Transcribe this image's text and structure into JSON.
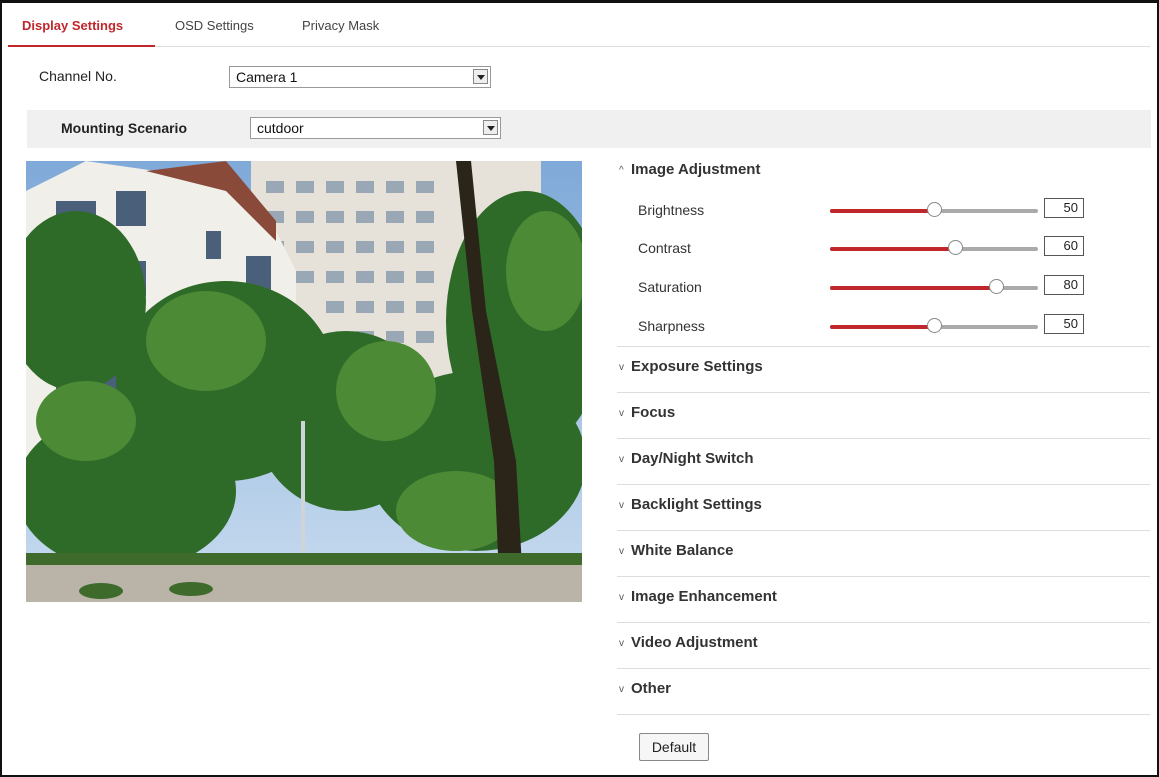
{
  "tabs": [
    {
      "label": "Display Settings",
      "active": true
    },
    {
      "label": "OSD Settings",
      "active": false
    },
    {
      "label": "Privacy Mask",
      "active": false
    }
  ],
  "channel": {
    "label": "Channel No.",
    "value": "Camera 1"
  },
  "mounting": {
    "label": "Mounting Scenario",
    "value": "cutdoor"
  },
  "image_adjustment": {
    "title": "Image Adjustment",
    "sliders": [
      {
        "name": "Brightness",
        "value": "50",
        "level": 0.5
      },
      {
        "name": "Contrast",
        "value": "60",
        "level": 0.6
      },
      {
        "name": "Saturation",
        "value": "80",
        "level": 0.8
      },
      {
        "name": "Sharpness",
        "value": "50",
        "level": 0.5
      }
    ]
  },
  "sections": [
    "Exposure Settings",
    "Focus",
    "Day/Night Switch",
    "Backlight Settings",
    "White Balance",
    "Image Enhancement",
    "Video Adjustment",
    "Other"
  ],
  "default_label": "Default",
  "colors": {
    "accent": "#c0272d"
  }
}
